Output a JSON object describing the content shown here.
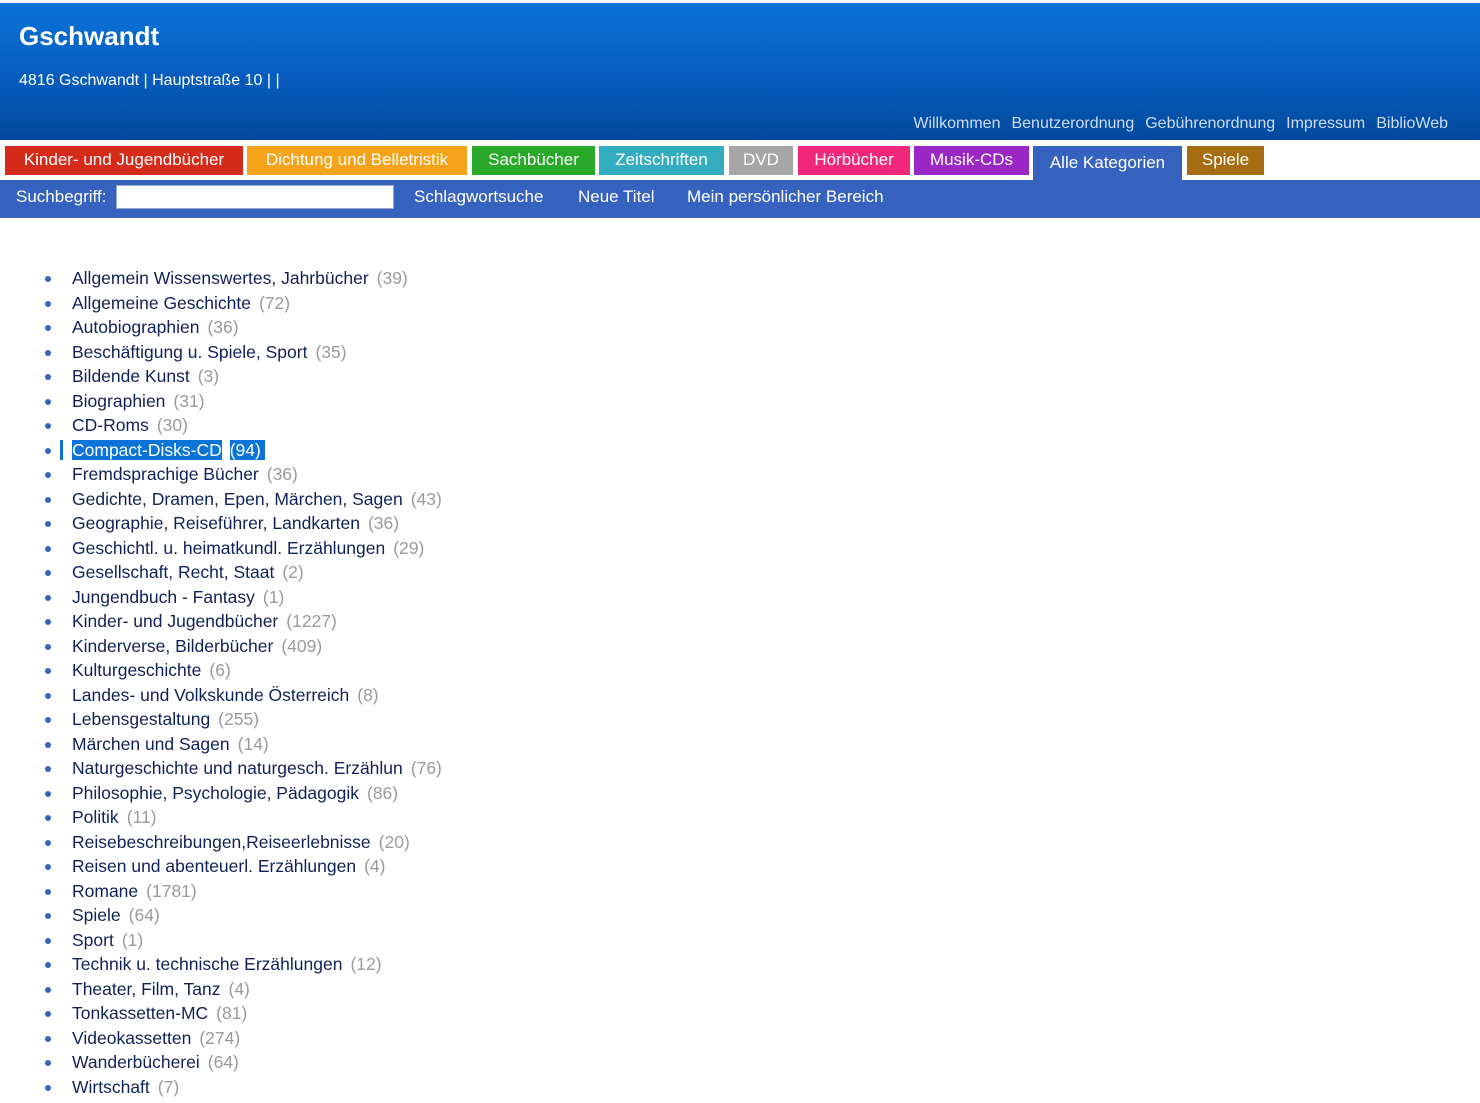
{
  "header": {
    "title": "Gschwandt",
    "address": "4816 Gschwandt | Hauptstraße 10 | |",
    "links": [
      "Willkommen",
      "Benutzerordnung",
      "Gebührenordnung",
      "Impressum",
      "BiblioWeb"
    ]
  },
  "category_tabs": [
    {
      "label": "Kinder- und Jugendbücher",
      "color": "#d42b1b"
    },
    {
      "label": "Dichtung und Belletristik",
      "color": "#f5a31a"
    },
    {
      "label": "Sachbücher",
      "color": "#29a829"
    },
    {
      "label": "Zeitschriften",
      "color": "#35adc0"
    },
    {
      "label": "DVD",
      "color": "#a6a6a6"
    },
    {
      "label": "Hörbücher",
      "color": "#f0277a"
    },
    {
      "label": "Musik-CDs",
      "color": "#9b27c4"
    },
    {
      "label": "Alle Kategorien",
      "color": "#3663bf"
    },
    {
      "label": "Spiele",
      "color": "#a66c12"
    }
  ],
  "search": {
    "label": "Suchbegriff:",
    "value": "",
    "links": [
      "Schlagwortsuche",
      "Neue Titel",
      "Mein persönlicher Bereich"
    ]
  },
  "categories": [
    {
      "name": "Allgemein Wissenswertes, Jahrbücher",
      "count": "(39)"
    },
    {
      "name": "Allgemeine Geschichte",
      "count": "(72)"
    },
    {
      "name": "Autobiographien",
      "count": "(36)"
    },
    {
      "name": "Beschäftigung u. Spiele, Sport",
      "count": "(35)"
    },
    {
      "name": "Bildende Kunst",
      "count": "(3)"
    },
    {
      "name": "Biographien",
      "count": "(31)"
    },
    {
      "name": "CD-Roms",
      "count": "(30)"
    },
    {
      "name": "Compact-Disks-CD",
      "count": "(94)",
      "selected": true
    },
    {
      "name": "Fremdsprachige Bücher",
      "count": "(36)"
    },
    {
      "name": "Gedichte, Dramen, Epen, Märchen, Sagen",
      "count": "(43)"
    },
    {
      "name": "Geographie, Reiseführer, Landkarten",
      "count": "(36)"
    },
    {
      "name": "Geschichtl. u. heimatkundl. Erzählungen",
      "count": "(29)"
    },
    {
      "name": "Gesellschaft, Recht, Staat",
      "count": "(2)"
    },
    {
      "name": "Jungendbuch - Fantasy",
      "count": "(1)"
    },
    {
      "name": "Kinder- und Jugendbücher",
      "count": "(1227)"
    },
    {
      "name": "Kinderverse, Bilderbücher",
      "count": "(409)"
    },
    {
      "name": "Kulturgeschichte",
      "count": "(6)"
    },
    {
      "name": "Landes- und Volkskunde Österreich",
      "count": "(8)"
    },
    {
      "name": "Lebensgestaltung",
      "count": "(255)"
    },
    {
      "name": "Märchen und Sagen",
      "count": "(14)"
    },
    {
      "name": "Naturgeschichte und naturgesch. Erzählun",
      "count": "(76)"
    },
    {
      "name": "Philosophie, Psychologie, Pädagogik",
      "count": "(86)"
    },
    {
      "name": "Politik",
      "count": "(11)"
    },
    {
      "name": "Reisebeschreibungen,Reiseerlebnisse",
      "count": "(20)"
    },
    {
      "name": "Reisen und abenteuerl. Erzählungen",
      "count": "(4)"
    },
    {
      "name": "Romane",
      "count": "(1781)"
    },
    {
      "name": "Spiele",
      "count": "(64)"
    },
    {
      "name": "Sport",
      "count": "(1)"
    },
    {
      "name": "Technik u. technische Erzählungen",
      "count": "(12)"
    },
    {
      "name": "Theater, Film, Tanz",
      "count": "(4)"
    },
    {
      "name": "Tonkassetten-MC",
      "count": "(81)"
    },
    {
      "name": "Videokassetten",
      "count": "(274)"
    },
    {
      "name": "Wanderbücherei",
      "count": "(64)"
    },
    {
      "name": "Wirtschaft",
      "count": "(7)"
    }
  ]
}
